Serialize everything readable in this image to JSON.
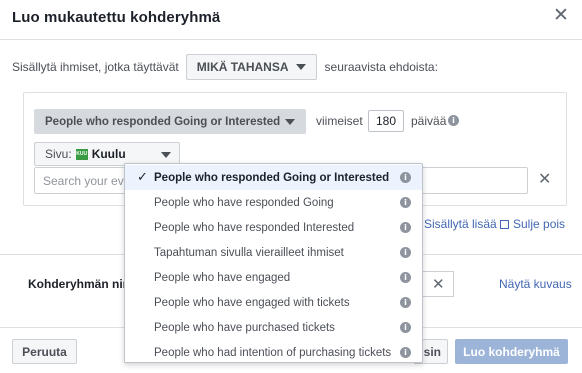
{
  "dialog": {
    "title": "Luo mukautettu kohderyhmä",
    "close_glyph": "✕"
  },
  "include": {
    "prefix": "Sisällytä ihmiset, jotka täyttävät",
    "match_value": "MIKÄ TAHANSA",
    "suffix": "seuraavista ehdoista:"
  },
  "rule": {
    "event_selected": "People who responded Going or Interested",
    "last_label": "viimeiset",
    "days_value": "180",
    "days_label": "päivää",
    "page_label": "Sivu:",
    "page_icon_text": "KUU",
    "page_name": "Kuulu",
    "search_placeholder": "Search your events",
    "remove_glyph": "✕"
  },
  "links": {
    "include_more": "Sisällytä lisää",
    "exclude": "Sulje pois"
  },
  "name_section": {
    "label": "Kohderyhmän nimi",
    "clear_glyph": "✕",
    "show_description": "Näytä kuvaus"
  },
  "footer": {
    "cancel": "Peruuta",
    "back": "Takaisin",
    "create": "Luo kohderyhmä"
  },
  "menu": {
    "check_glyph": "✓",
    "info_glyph": "i",
    "items": [
      {
        "label": "People who responded Going or Interested",
        "selected": true
      },
      {
        "label": "People who have responded Going",
        "selected": false
      },
      {
        "label": "People who have responded Interested",
        "selected": false
      },
      {
        "label": "Tapahtuman sivulla vierailleet ihmiset",
        "selected": false
      },
      {
        "label": "People who have engaged",
        "selected": false
      },
      {
        "label": "People who have engaged with tickets",
        "selected": false
      },
      {
        "label": "People who have purchased tickets",
        "selected": false
      },
      {
        "label": "People who had intention of purchasing tickets",
        "selected": false
      }
    ]
  },
  "colors": {
    "link": "#4267b2",
    "primary_disabled": "#9cb4d8",
    "selected_row": "#ecf3ff",
    "page_icon": "#3a9b45"
  }
}
